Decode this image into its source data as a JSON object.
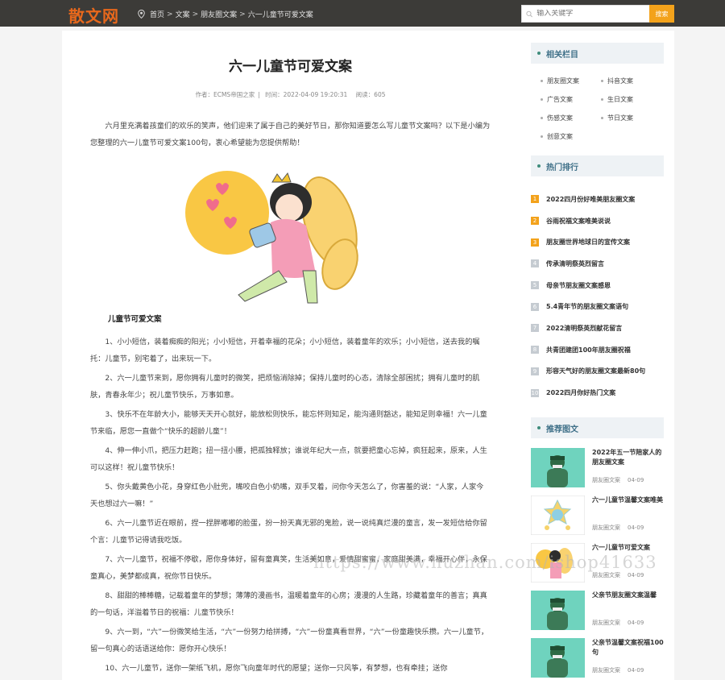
{
  "header": {
    "logo": "散文网",
    "breadcrumb": [
      "首页",
      "文案",
      "朋友圈文案",
      "六一儿童节可爱文案"
    ],
    "breadcrumb_sep": ">",
    "search_placeholder": "输入关键字",
    "search_button": "搜索"
  },
  "article": {
    "title": "六一儿童节可爱文案",
    "author": "作者：ECMS帝国之家",
    "time": "时间：2022-04-09 19:20:31",
    "views": "阅读：605",
    "intro": "六月里充满着孩童们的欢乐的笑声，他们迎来了属于自己的美好节日，那你知道要怎么写儿童节文案吗？以下是小编为您整理的六一儿童节可爱文案100句，衷心希望能为您提供帮助！",
    "subhead": "儿童节可爱文案",
    "paragraphs": [
      "1、小小短信，装着痴痴的阳光；小小短信，开着幸福的花朵；小小短信，装着童年的欢乐；小小短信，送去我的嘱托：儿童节，别宅着了，出来玩一下。",
      "2、六一儿童节来到，愿你拥有儿童时的微笑，把烦恼消除掉；保持儿童时的心态，清除全部困扰；拥有儿童时的肌肤，青春永年少；祝儿童节快乐，万事如意。",
      "3、快乐不在年龄大小，能够天天开心就好，能放松则快乐，能忘怀则知足，能沟通则豁达，能知足则幸福！六一儿童节来临，愿您一直做个“快乐的超龄儿童”！",
      "4、伸一伸小爪，把压力赶跑；扭一扭小腰，把孤独释放；谁说年纪大一点，就要把童心忘掉，疯狂起来，原来，人生可以这样！祝儿童节快乐！",
      "5、你头戴黄色小花，身穿红色小肚兜，嘴咬白色小奶嘴，双手叉着，问你今天怎么了，你害羞的说：“人家，人家今天也想过六一嘛！”",
      "6、六一儿童节近在眼前，捏一捏胖嘟嘟的脸蛋，扮一扮天真无邪的鬼脸，说一说纯真烂漫的童言，发一发短信给你留个言：儿童节记得请我吃饭。",
      "7、六一儿童节，祝福不停歇，愿你身体好，留有童真笑，生活美如意，爱情甜蜜蜜，家庭甜美满，幸福开心伴，永保童真心，美梦都成真，祝你节日快乐。",
      "8、甜甜的棒棒糖，记载着童年的梦想；薄薄的漫画书，温暖着童年的心房；漫漫的人生路，珍藏着童年的善言；真真的一句话，洋溢着节日的祝福：儿童节快乐！",
      "9、六一到，“六”一份微笑给生活，“六”一份努力给拼搏，“六”一份童真看世界，“六”一份童趣快乐攒。六一儿童节，留一句真心的话语送给你：愿你开心快乐！",
      "10、六一儿童节，送你一架纸飞机，愿你飞向童年时代的愿望；送你一只风筝，有梦想，也有牵挂；送你"
    ]
  },
  "sidebar": {
    "related_title": "相关栏目",
    "categories": [
      "朋友圈文案",
      "抖音文案",
      "广告文案",
      "生日文案",
      "伤感文案",
      "节日文案",
      "创意文案"
    ],
    "hot_title": "热门排行",
    "hot_items": [
      {
        "num": "1",
        "title": "2022四月份好唯美朋友圈文案"
      },
      {
        "num": "2",
        "title": "谷雨祝福文案唯美说说"
      },
      {
        "num": "3",
        "title": "朋友圈世界地球日的宣传文案"
      },
      {
        "num": "4",
        "title": "传承清明祭英烈留言"
      },
      {
        "num": "5",
        "title": "母亲节朋友圈文案感恩"
      },
      {
        "num": "6",
        "title": "5.4青年节的朋友圈文案语句"
      },
      {
        "num": "7",
        "title": "2022清明祭英烈献花留言"
      },
      {
        "num": "8",
        "title": "共青团建团100年朋友圈祝福"
      },
      {
        "num": "9",
        "title": "形容天气好的朋友圈文案最新80句"
      },
      {
        "num": "10",
        "title": "2022四月你好热门文案"
      }
    ],
    "hot_colors": {
      "top": "#f3a21b",
      "rest": "#c5cbd1"
    },
    "pic_title": "推荐图文",
    "pic_items": [
      {
        "title": "2022年五一节陪家人的朋友圈文案",
        "cat": "朋友圈文案",
        "date": "04-09"
      },
      {
        "title": "六一儿童节温馨文案唯美",
        "cat": "朋友圈文案",
        "date": "04-09"
      },
      {
        "title": "六一儿童节可爱文案",
        "cat": "朋友圈文案",
        "date": "04-09"
      },
      {
        "title": "父亲节朋友圈文案温馨",
        "cat": "朋友圈文案",
        "date": "04-09"
      },
      {
        "title": "父亲节温馨文案祝福100句",
        "cat": "朋友圈文案",
        "date": "04-09"
      }
    ]
  },
  "watermark": "https://www.huzhan.com/ishop41633",
  "colors": {
    "accent": "#f3a21b",
    "topbar": "#3c3b38",
    "logo": "#e8681c",
    "section_title": "#3f7088"
  }
}
